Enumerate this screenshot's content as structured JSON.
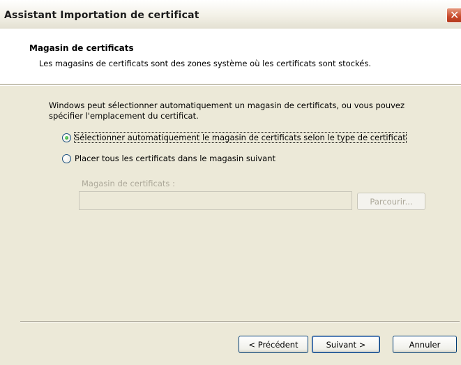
{
  "window": {
    "title": "Assistant Importation de certificat"
  },
  "header": {
    "title": "Magasin de certificats",
    "description": "Les magasins de certificats sont des zones système où les certificats sont stockés."
  },
  "body": {
    "intro_line1": "Windows peut sélectionner automatiquement un magasin de certificats, ou vous pouvez",
    "intro_line2": "spécifier l'emplacement du certificat.",
    "options": [
      {
        "label": "Sélectionner automatiquement le magasin de certificats selon le type de certificat",
        "selected": true
      },
      {
        "label": "Placer tous les certificats dans le magasin suivant",
        "selected": false
      }
    ],
    "store_label": "Magasin de certificats :",
    "store_value": "",
    "browse_label": "Parcourir..."
  },
  "footer": {
    "back_label": "< Précédent",
    "next_label": "Suivant >",
    "cancel_label": "Annuler"
  }
}
